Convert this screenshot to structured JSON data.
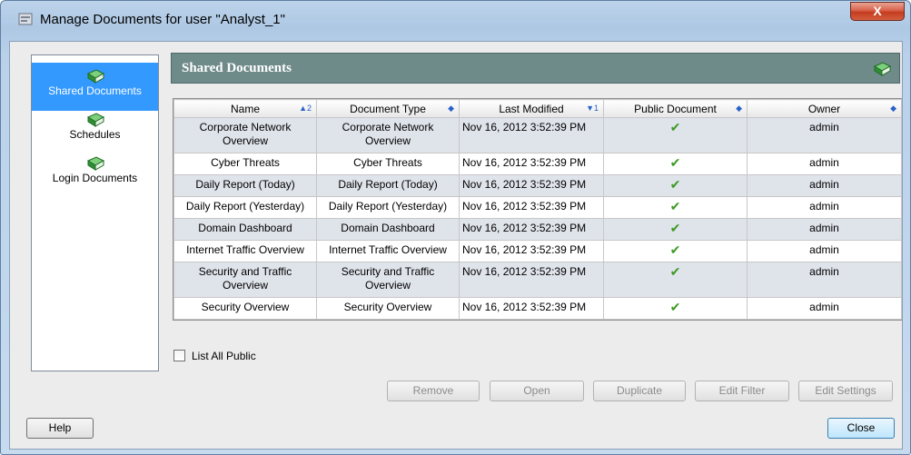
{
  "window": {
    "title": "Manage Documents for user \"Analyst_1\"",
    "close_symbol": "X"
  },
  "nav": {
    "items": [
      {
        "label": "Shared Documents",
        "icon": "book-icon",
        "selected": true
      },
      {
        "label": "Schedules",
        "icon": "book-icon",
        "selected": false
      },
      {
        "label": "Login Documents",
        "icon": "book-icon",
        "selected": false
      }
    ]
  },
  "panel": {
    "title": "Shared Documents"
  },
  "table": {
    "columns": [
      {
        "label": "Name",
        "sort": "▲2"
      },
      {
        "label": "Document Type",
        "sort": "◆"
      },
      {
        "label": "Last Modified",
        "sort": "▼1"
      },
      {
        "label": "Public Document",
        "sort": "◆"
      },
      {
        "label": "Owner",
        "sort": "◆"
      }
    ],
    "rows": [
      {
        "name": "Corporate Network Overview",
        "type": "Corporate Network Overview",
        "modified": "Nov 16, 2012 3:52:39 PM",
        "public": "✔",
        "owner": "admin"
      },
      {
        "name": "Cyber Threats",
        "type": "Cyber Threats",
        "modified": "Nov 16, 2012 3:52:39 PM",
        "public": "✔",
        "owner": "admin"
      },
      {
        "name": "Daily Report (Today)",
        "type": "Daily Report (Today)",
        "modified": "Nov 16, 2012 3:52:39 PM",
        "public": "✔",
        "owner": "admin"
      },
      {
        "name": "Daily Report (Yesterday)",
        "type": "Daily Report (Yesterday)",
        "modified": "Nov 16, 2012 3:52:39 PM",
        "public": "✔",
        "owner": "admin"
      },
      {
        "name": "Domain Dashboard",
        "type": "Domain Dashboard",
        "modified": "Nov 16, 2012 3:52:39 PM",
        "public": "✔",
        "owner": "admin"
      },
      {
        "name": "Internet Traffic Overview",
        "type": "Internet Traffic Overview",
        "modified": "Nov 16, 2012 3:52:39 PM",
        "public": "✔",
        "owner": "admin"
      },
      {
        "name": "Security and Traffic Overview",
        "type": "Security and Traffic Overview",
        "modified": "Nov 16, 2012 3:52:39 PM",
        "public": "✔",
        "owner": "admin"
      },
      {
        "name": "Security Overview",
        "type": "Security Overview",
        "modified": "Nov 16, 2012 3:52:39 PM",
        "public": "✔",
        "owner": "admin"
      }
    ]
  },
  "options": {
    "list_all_public": "List All Public"
  },
  "buttons": {
    "remove": "Remove",
    "open": "Open",
    "duplicate": "Duplicate",
    "edit_filter": "Edit Filter",
    "edit_settings": "Edit Settings",
    "help": "Help",
    "close": "Close"
  },
  "colors": {
    "header_bg": "#6e8a89",
    "selected_nav": "#3399ff",
    "alt_row": "#dfe3ea",
    "check": "#3d9a24"
  }
}
